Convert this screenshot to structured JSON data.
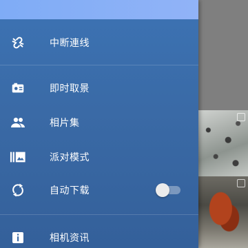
{
  "drawer": {
    "items": [
      {
        "label": "中断連线",
        "icon": "link-off-icon"
      },
      {
        "label": "即时取景",
        "icon": "live-view-icon"
      },
      {
        "label": "相片集",
        "icon": "people-icon"
      },
      {
        "label": "派对模式",
        "icon": "party-mode-icon"
      },
      {
        "label": "自动下载",
        "icon": "sync-icon",
        "toggle_on": false
      },
      {
        "label": "相机资讯",
        "icon": "info-icon"
      }
    ]
  },
  "colors": {
    "drawer_bg": "#3a6aa6",
    "header_bg": "#86aff6",
    "text": "#ffffff"
  }
}
